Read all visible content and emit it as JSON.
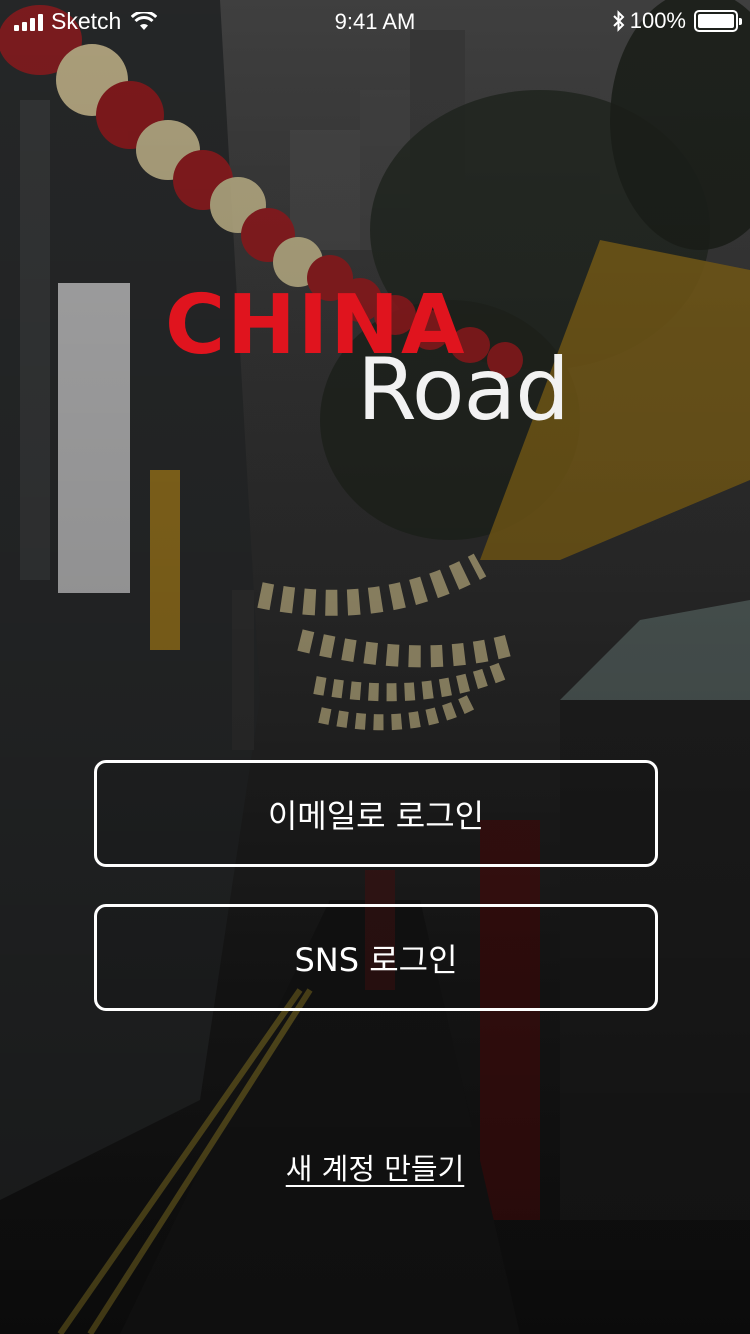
{
  "status_bar": {
    "carrier": "Sketch",
    "time": "9:41 AM",
    "battery_percent_label": "100%",
    "battery_level": 1.0
  },
  "logo": {
    "word_top": "CHINA",
    "word_bottom": "Road",
    "brand_color": "#e0141e"
  },
  "actions": {
    "email_login": "이메일로 로그인",
    "sns_login": "SNS 로그인",
    "create_account": "새 계정 만들기"
  },
  "colors": {
    "text": "#ffffff",
    "button_border": "#ffffff"
  },
  "icons": {
    "signal": "cellular-signal-icon",
    "wifi": "wifi-icon",
    "bluetooth": "bluetooth-icon",
    "battery": "battery-icon"
  }
}
